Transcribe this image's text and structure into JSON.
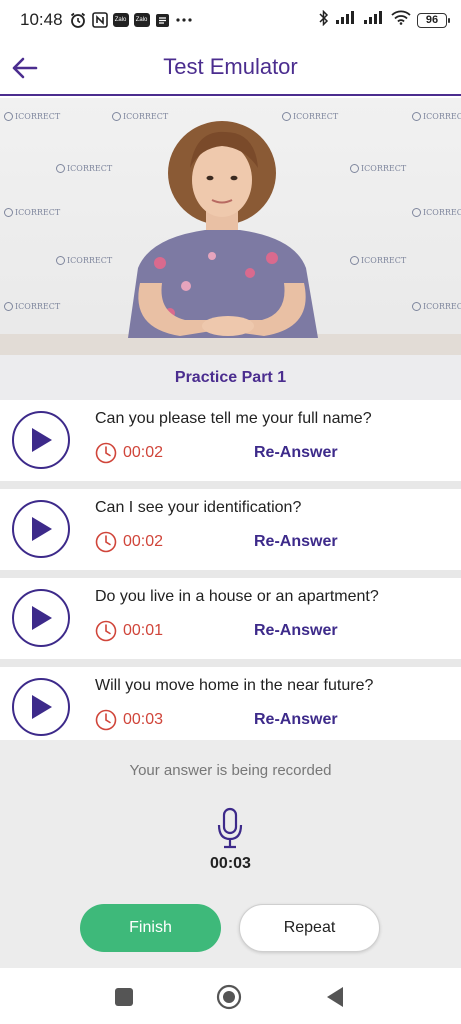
{
  "status_bar": {
    "time": "10:48",
    "zalo_label": "Zalo",
    "battery": "96"
  },
  "header": {
    "title": "Test Emulator",
    "accent_color": "#4b2d8f"
  },
  "video": {
    "watermark": "ICORRECT"
  },
  "practice_label": "Practice Part 1",
  "questions": [
    {
      "text": "Can you please tell me your full name?",
      "time": "00:02",
      "action": "Re-Answer"
    },
    {
      "text": "Can I see your identification?",
      "time": "00:02",
      "action": "Re-Answer"
    },
    {
      "text": "Do you live in a house or an apartment?",
      "time": "00:01",
      "action": "Re-Answer"
    },
    {
      "text": "Will you move home in the near future?",
      "time": "00:03",
      "action": "Re-Answer"
    }
  ],
  "recording": {
    "status_text": "Your answer is being recorded",
    "elapsed": "00:03",
    "icon": "microphone-icon"
  },
  "buttons": {
    "finish": "Finish",
    "repeat": "Repeat"
  },
  "colors": {
    "finish_green": "#3eb97a",
    "timer_red": "#d0453a",
    "purple": "#3d2a8a"
  }
}
